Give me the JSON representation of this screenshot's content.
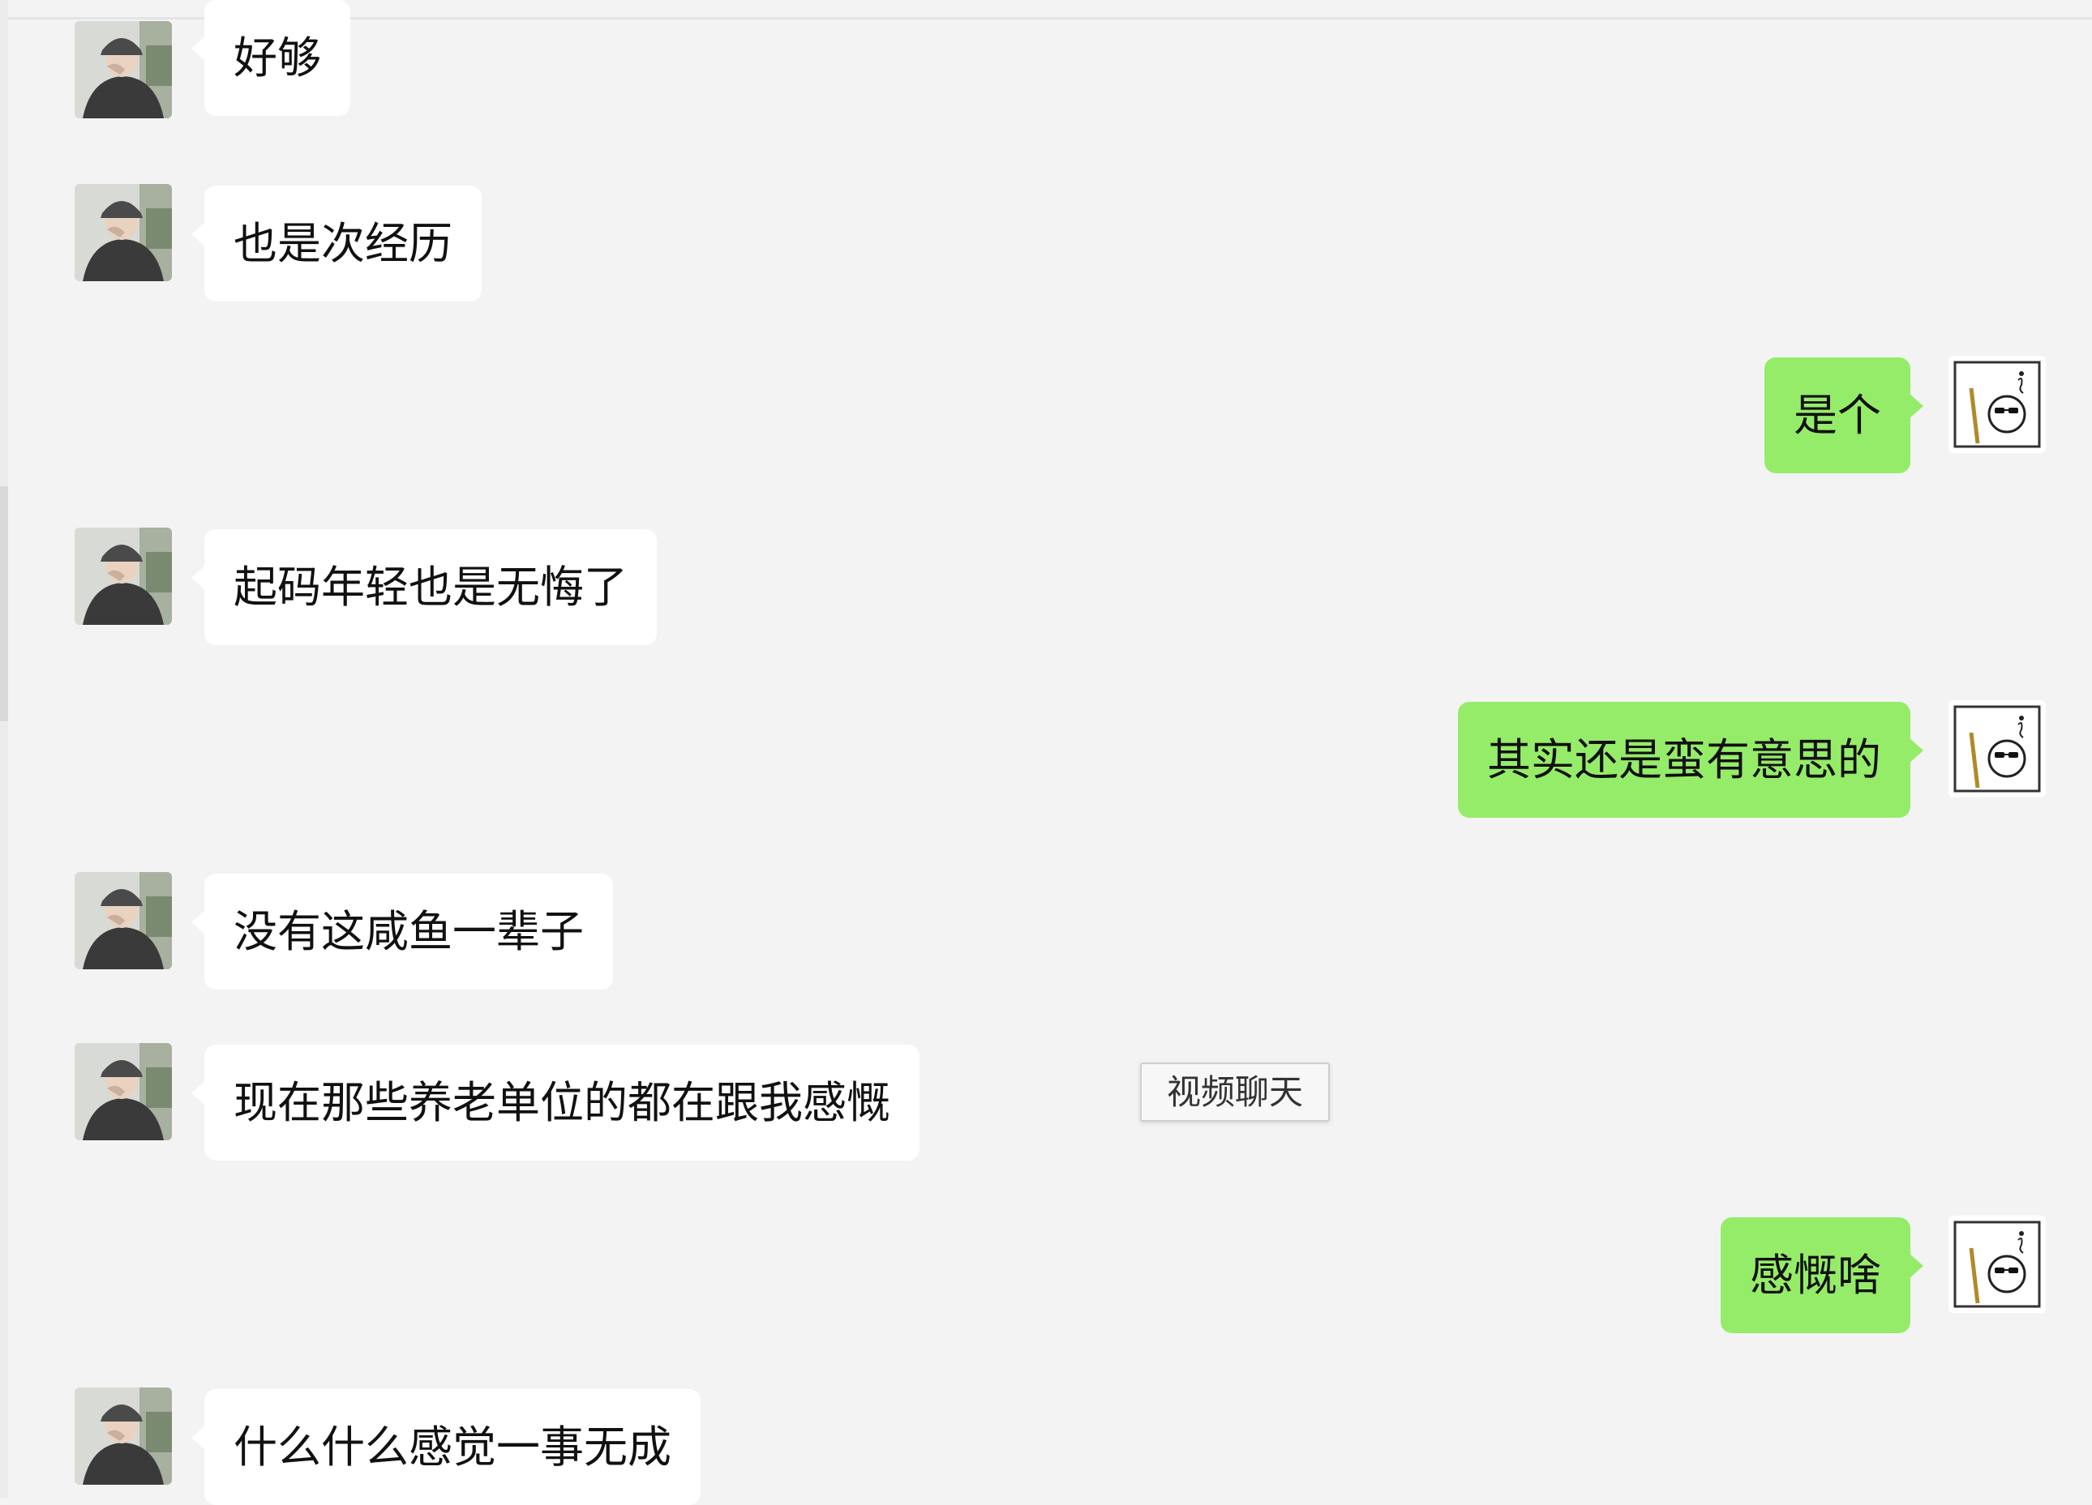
{
  "conversation": {
    "messages": [
      {
        "side": "left",
        "text": "好够"
      },
      {
        "side": "left",
        "text": "也是次经历"
      },
      {
        "side": "right",
        "text": "是个"
      },
      {
        "side": "left",
        "text": "起码年轻也是无悔了"
      },
      {
        "side": "right",
        "text": "其实还是蛮有意思的"
      },
      {
        "side": "left",
        "text": "没有这咸鱼一辈子"
      },
      {
        "side": "left",
        "text": "现在那些养老单位的都在跟我感慨"
      },
      {
        "side": "right",
        "text": "感慨啥"
      },
      {
        "side": "left",
        "text": "什么什么感觉一事无成"
      }
    ]
  },
  "tooltip": {
    "text": "视频聊天"
  },
  "colors": {
    "background": "#f3f3f3",
    "incoming_bubble": "#ffffff",
    "outgoing_bubble": "#95ec69",
    "text": "#111111"
  },
  "icons": {
    "contact_avatar": "person-in-cap-photo",
    "own_avatar": "sketch-figure-with-sunglasses"
  }
}
